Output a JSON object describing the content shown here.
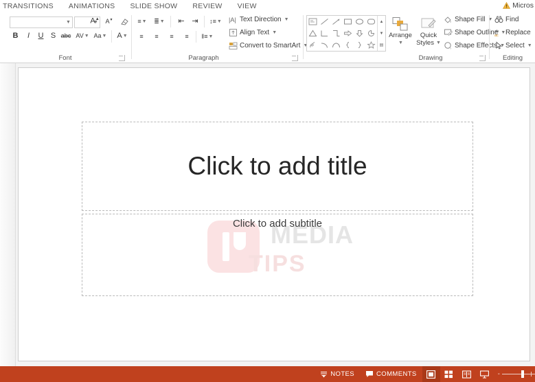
{
  "tabs": [
    {
      "label": "TRANSITIONS"
    },
    {
      "label": "ANIMATIONS"
    },
    {
      "label": "SLIDE SHOW"
    },
    {
      "label": "REVIEW"
    },
    {
      "label": "VIEW"
    }
  ],
  "account": {
    "warning_icon": "warning-triangle-icon",
    "label": "Micros",
    "warning_color": "#e8b23a"
  },
  "ribbon": {
    "font_group": {
      "label": "Font",
      "font_name": {
        "value": "",
        "placeholder": ""
      },
      "font_size": {
        "value": "",
        "placeholder": ""
      },
      "buttons": [
        {
          "name": "increase-font-size",
          "glyph": "A"
        },
        {
          "name": "decrease-font-size",
          "glyph": "A"
        },
        {
          "name": "clear-formatting",
          "glyph": "✐"
        },
        {
          "name": "bold",
          "glyph": "B"
        },
        {
          "name": "italic",
          "glyph": "I"
        },
        {
          "name": "underline",
          "glyph": "U"
        },
        {
          "name": "text-shadow",
          "glyph": "S"
        },
        {
          "name": "strikethrough",
          "glyph": "abc"
        },
        {
          "name": "character-spacing",
          "glyph": "AV"
        },
        {
          "name": "change-case",
          "glyph": "Aa"
        },
        {
          "name": "font-color",
          "glyph": "A"
        }
      ]
    },
    "paragraph_group": {
      "label": "Paragraph",
      "buttons": [
        {
          "name": "bullets",
          "glyph": "≡"
        },
        {
          "name": "numbering",
          "glyph": "≣"
        },
        {
          "name": "decrease-indent",
          "glyph": "⇤"
        },
        {
          "name": "increase-indent",
          "glyph": "⇥"
        },
        {
          "name": "line-spacing",
          "glyph": "↕"
        },
        {
          "name": "align-left",
          "glyph": "≡"
        },
        {
          "name": "align-center",
          "glyph": "≡"
        },
        {
          "name": "align-right",
          "glyph": "≡"
        },
        {
          "name": "justify",
          "glyph": "≡"
        },
        {
          "name": "columns",
          "glyph": "‖"
        }
      ],
      "text_direction": "Text Direction",
      "align_text": "Align Text",
      "convert_smartart": "Convert to SmartArt"
    },
    "drawing_group": {
      "label": "Drawing",
      "shapes_row1": [
        "textbox",
        "line",
        "arrow-line",
        "rectangle",
        "oval",
        "rounded-rectangle"
      ],
      "shapes_row2": [
        "triangle",
        "right-angle",
        "l-shape",
        "right-arrow",
        "down-arrow",
        "pie"
      ],
      "shapes_row3": [
        "freeform",
        "curve-arc",
        "arc",
        "left-brace",
        "right-brace",
        "star"
      ],
      "arrange": "Arrange",
      "quick_styles_line1": "Quick",
      "quick_styles_line2": "Styles",
      "shape_fill": "Shape Fill",
      "shape_outline": "Shape Outline",
      "shape_effects": "Shape Effects"
    },
    "editing_group": {
      "label": "Editing",
      "find": "Find",
      "replace": "Replace",
      "select": "Select"
    }
  },
  "slide": {
    "title_placeholder": "Click to add title",
    "subtitle_placeholder": "Click to add subtitle",
    "watermark_main": "MEDIA",
    "watermark_sub": "TIPS"
  },
  "statusbar": {
    "notes": "NOTES",
    "comments": "COMMENTS",
    "views": [
      {
        "name": "normal-view",
        "active": true
      },
      {
        "name": "slide-sorter-view",
        "active": false
      },
      {
        "name": "reading-view",
        "active": false
      },
      {
        "name": "slide-show-view",
        "active": false
      }
    ],
    "zoom_out": "-",
    "background": "#c0411e"
  }
}
